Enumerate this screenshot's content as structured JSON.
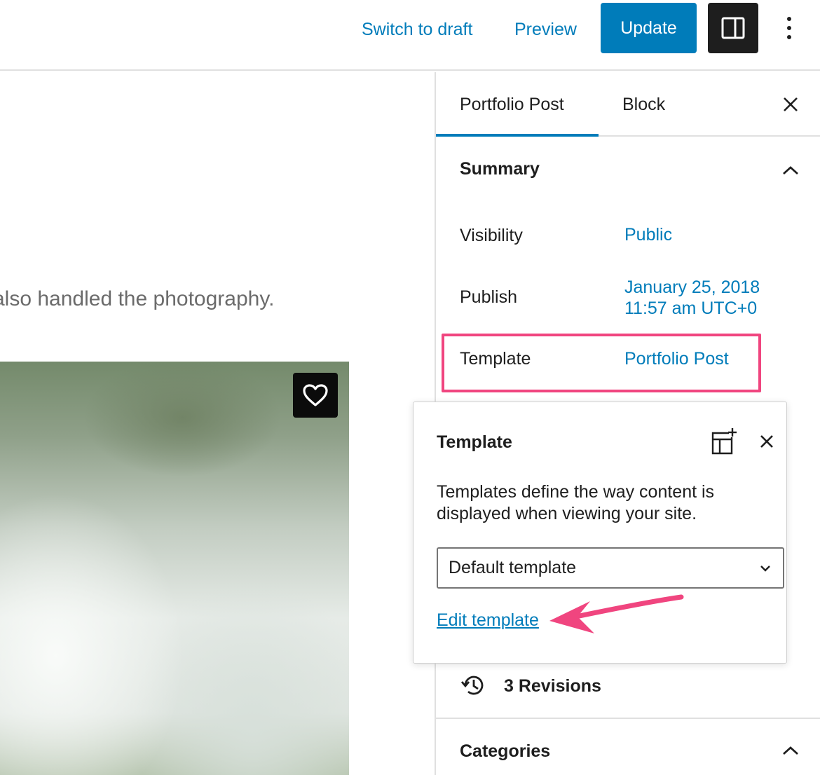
{
  "toolbar": {
    "switch_to_draft": "Switch to draft",
    "preview": "Preview",
    "update": "Update",
    "settings_icon": "sidebar-toggle-icon",
    "more_icon": "more-vertical-icon"
  },
  "canvas": {
    "paragraph_fragment": "also handled the photography.",
    "favorite_icon": "heart-icon"
  },
  "sidebar": {
    "tabs": [
      {
        "label": "Portfolio Post",
        "active": true
      },
      {
        "label": "Block",
        "active": false
      }
    ],
    "summary": {
      "title": "Summary",
      "rows": [
        {
          "label": "Visibility",
          "value": "Public"
        },
        {
          "label": "Publish",
          "value_line1": "January 25, 2018",
          "value_line2": "11:57 am UTC+0"
        },
        {
          "label": "Template",
          "value": "Portfolio Post"
        }
      ]
    },
    "revisions": {
      "label": "3 Revisions"
    },
    "categories": {
      "title": "Categories"
    }
  },
  "template_popover": {
    "title": "Template",
    "description": "Templates define the way content is displayed when viewing your site.",
    "select_value": "Default template",
    "edit_link": "Edit template"
  },
  "colors": {
    "accent": "#007cba",
    "highlight": "#f0457f",
    "dark": "#1e1e1e"
  }
}
